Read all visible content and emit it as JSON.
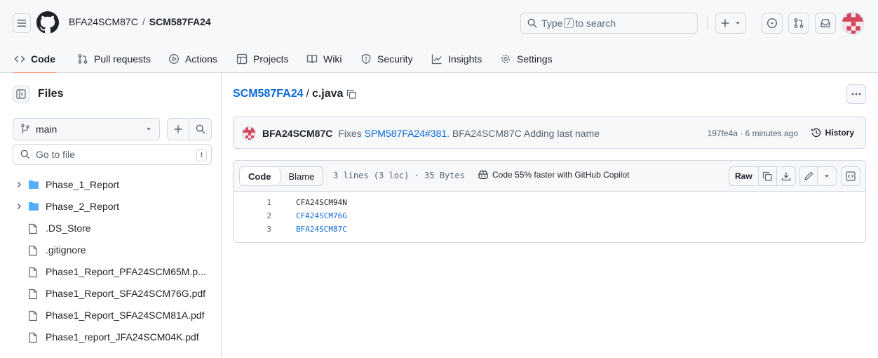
{
  "header": {
    "owner": "BFA24SCM87C",
    "separator": "/",
    "repo": "SCM587FA24",
    "search_prefix": "Type",
    "search_key": "/",
    "search_suffix": "to search"
  },
  "tabs": [
    {
      "label": "Code",
      "icon": "code-icon",
      "active": true
    },
    {
      "label": "Pull requests",
      "icon": "pull-request-icon"
    },
    {
      "label": "Actions",
      "icon": "play-icon"
    },
    {
      "label": "Projects",
      "icon": "table-icon"
    },
    {
      "label": "Wiki",
      "icon": "book-icon"
    },
    {
      "label": "Security",
      "icon": "shield-icon"
    },
    {
      "label": "Insights",
      "icon": "graph-icon"
    },
    {
      "label": "Settings",
      "icon": "gear-icon"
    }
  ],
  "sidebar": {
    "title": "Files",
    "branch": "main",
    "goto_placeholder": "Go to file",
    "goto_shortcut": "t",
    "items": [
      {
        "name": "Phase_1_Report",
        "type": "folder"
      },
      {
        "name": "Phase_2_Report",
        "type": "folder"
      },
      {
        "name": ".DS_Store",
        "type": "file"
      },
      {
        "name": ".gitignore",
        "type": "file"
      },
      {
        "name": "Phase1_Report_PFA24SCM65M.p...",
        "type": "file"
      },
      {
        "name": "Phase1_Report_SFA24SCM76G.pdf",
        "type": "file"
      },
      {
        "name": "Phase1_Report_SFA24SCM81A.pdf",
        "type": "file"
      },
      {
        "name": "Phase1_report_JFA24SCM04K.pdf",
        "type": "file"
      }
    ]
  },
  "file_path": {
    "repo": "SCM587FA24",
    "separator": "/",
    "file": "c.java"
  },
  "commit": {
    "author": "BFA24SCM87C",
    "message_prefix": "Fixes",
    "ref": "SPM587FA24#381",
    "message_suffix": ". BFA24SCM87C Adding last name",
    "meta": "197fe4a · 6 minutes ago",
    "history_label": "History"
  },
  "file_view": {
    "code_tab": "Code",
    "blame_tab": "Blame",
    "info": "3 lines (3 loc) · 35 Bytes",
    "copilot": "Code 55% faster with GitHub Copilot",
    "raw_label": "Raw"
  },
  "code": [
    {
      "n": "1",
      "text": "CFA24SCM94N"
    },
    {
      "n": "2",
      "text": "CFA24SCM76G"
    },
    {
      "n": "3",
      "text": "BFA24SCM87C"
    }
  ],
  "colors": {
    "link": "#0969da",
    "border": "#d0d7de",
    "muted": "#59636e",
    "active_tab_underline": "#fd8c73",
    "folder": "#54aeff"
  }
}
